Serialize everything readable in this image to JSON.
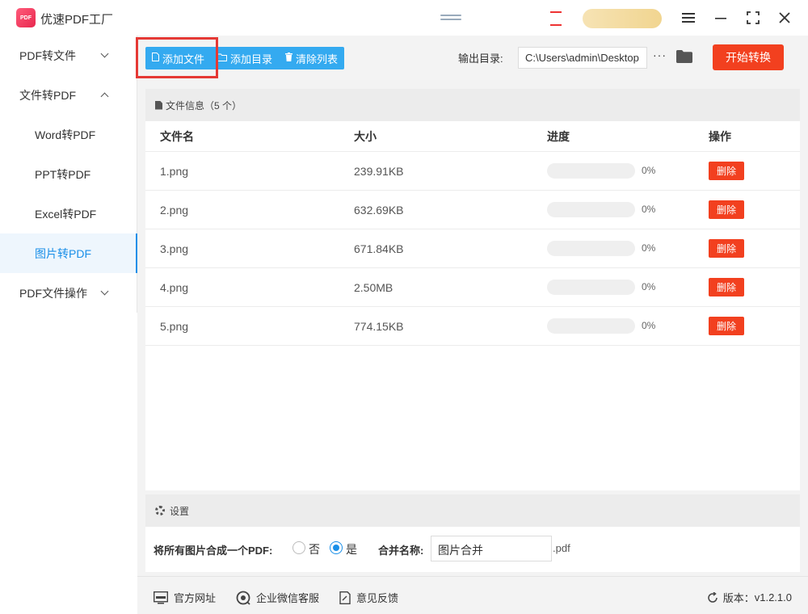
{
  "app": {
    "title": "优速PDF工厂",
    "logo_text": "PDF"
  },
  "window": {
    "menu_icon": "menu-icon",
    "minimize_icon": "minimize-icon",
    "maximize_icon": "maximize-icon",
    "close_icon": "close-icon"
  },
  "sidebar": {
    "items": [
      {
        "label": "PDF转文件",
        "type": "group",
        "expanded": false
      },
      {
        "label": "文件转PDF",
        "type": "group",
        "expanded": true
      },
      {
        "label": "Word转PDF",
        "type": "sub",
        "active": false
      },
      {
        "label": "PPT转PDF",
        "type": "sub",
        "active": false
      },
      {
        "label": "Excel转PDF",
        "type": "sub",
        "active": false
      },
      {
        "label": "图片转PDF",
        "type": "sub",
        "active": true
      },
      {
        "label": "PDF文件操作",
        "type": "group",
        "expanded": false
      }
    ]
  },
  "toolbar": {
    "add_file": "添加文件",
    "add_folder": "添加目录",
    "clear_list": "清除列表",
    "output_label": "输出目录:",
    "output_path": "C:\\Users\\admin\\Desktop",
    "more": "···",
    "start": "开始转换"
  },
  "file_info": {
    "title": "文件信息",
    "count": "（5 个）",
    "columns": [
      "文件名",
      "大小",
      "进度",
      "操作"
    ],
    "rows": [
      {
        "name": "1.png",
        "size": "239.91KB",
        "progress": 0,
        "progress_text": "0%",
        "action": "删除"
      },
      {
        "name": "2.png",
        "size": "632.69KB",
        "progress": 0,
        "progress_text": "0%",
        "action": "删除"
      },
      {
        "name": "3.png",
        "size": "671.84KB",
        "progress": 0,
        "progress_text": "0%",
        "action": "删除"
      },
      {
        "name": "4.png",
        "size": "2.50MB",
        "progress": 0,
        "progress_text": "0%",
        "action": "删除"
      },
      {
        "name": "5.png",
        "size": "774.15KB",
        "progress": 0,
        "progress_text": "0%",
        "action": "删除"
      }
    ]
  },
  "settings": {
    "title": "设置",
    "merge_label": "将所有图片合成一个PDF:",
    "option_no": "否",
    "option_yes": "是",
    "selected": "是",
    "merge_name_label": "合并名称:",
    "merge_name_value": "图片合并",
    "ext": ".pdf"
  },
  "footer": {
    "website": "官方网址",
    "wechat": "企业微信客服",
    "feedback": "意见反馈",
    "version_label": "版本：",
    "version": "v1.2.1.0"
  },
  "colors": {
    "accent": "#34aaf0",
    "danger": "#f2401f",
    "highlight": "#e53935",
    "active_nav": "#1a8fe8"
  }
}
